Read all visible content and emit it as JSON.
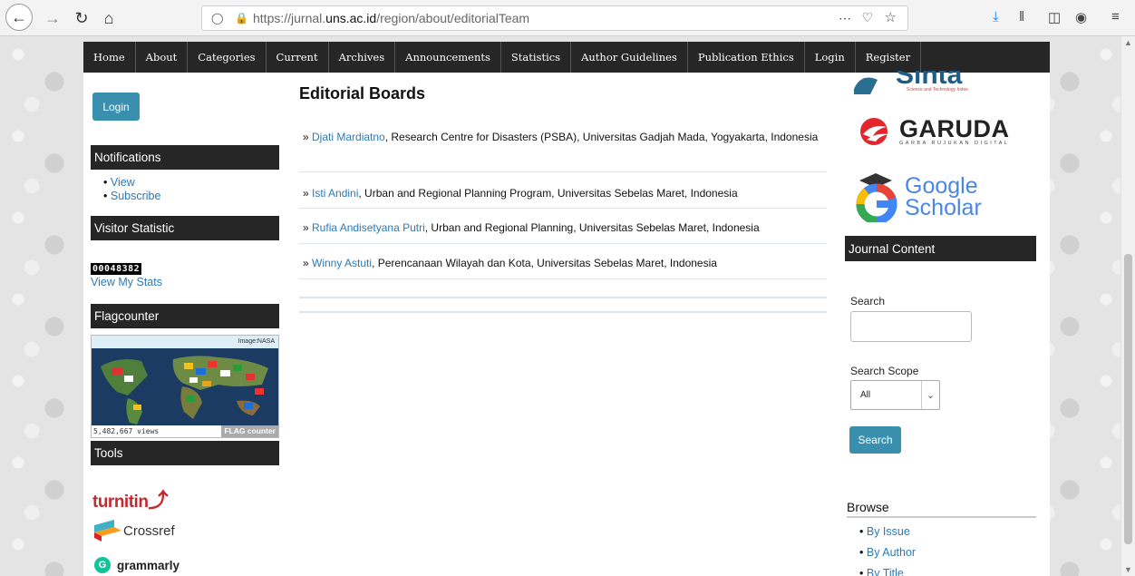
{
  "browser": {
    "url_prefix": "https://jurnal.",
    "url_domain": "uns.ac.id",
    "url_path": "/region/about/editorialTeam"
  },
  "nav": [
    "Home",
    "About",
    "Categories",
    "Current",
    "Archives",
    "Announcements",
    "Statistics",
    "Author Guidelines",
    "Publication Ethics",
    "Login",
    "Register"
  ],
  "left": {
    "login_label": "Login",
    "notifications_title": "Notifications",
    "notifications_items": [
      "View",
      "Subscribe"
    ],
    "visitor_title": "Visitor Statistic",
    "counter": "00048382",
    "view_stats": "View My Stats",
    "flag_title": "Flagcounter",
    "flag_image_credit": "Image:NASA",
    "flag_views": "5,482,667 views",
    "flag_brand": "FLAG counter",
    "tools_title": "Tools",
    "turnitin": "turnitin",
    "crossref": "Crossref",
    "grammarly": "grammarly"
  },
  "main": {
    "title": "Editorial Boards",
    "members": [
      {
        "name": "Djati Mardiatno",
        "affiliation": ", Research Centre for Disasters (PSBA), Universitas Gadjah Mada, Yogyakarta, Indonesia"
      },
      {
        "name": "Isti Andini",
        "affiliation": ", Urban and Regional Planning Program, Universitas Sebelas Maret, Indonesia"
      },
      {
        "name": "Rufia Andisetyana Putri",
        "affiliation": ", Urban and Regional Planning, Universitas Sebelas Maret, Indonesia"
      },
      {
        "name": "Winny Astuti",
        "affiliation": ", Perencanaan Wilayah dan Kota, Universitas Sebelas Maret, Indonesia"
      }
    ]
  },
  "right": {
    "sinta_sub": "Science and Technology Index",
    "garuda": "GARUDA",
    "garuda_sub": "GARBA RUJUKAN DIGITAL",
    "scholar_1": "Google",
    "scholar_2": "Scholar",
    "journal_content_title": "Journal Content",
    "search_label": "Search",
    "scope_label": "Search Scope",
    "scope_value": "All",
    "search_button": "Search",
    "browse_title": "Browse",
    "browse_items": [
      "By Issue",
      "By Author",
      "By Title"
    ]
  },
  "colors": {
    "nav_bg": "#262626",
    "link": "#2a7ab8",
    "button": "#3b8fae"
  }
}
